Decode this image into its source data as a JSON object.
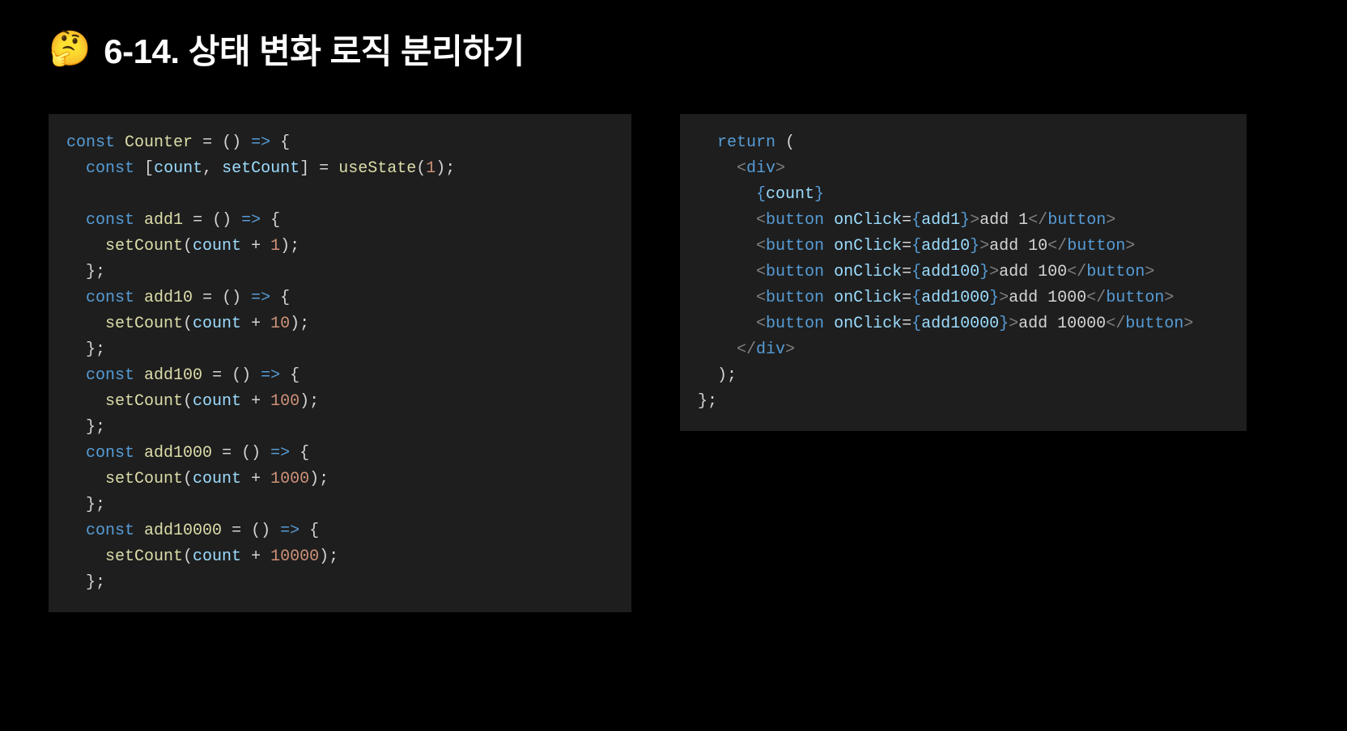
{
  "header": {
    "emoji": "🤔",
    "title": "6-14. 상태 변화 로직 분리하기"
  },
  "code_left": {
    "component_name": "Counter",
    "state_var": "count",
    "state_setter": "setCount",
    "hook": "useState",
    "initial": "1",
    "functions": [
      {
        "name": "add1",
        "value": "1"
      },
      {
        "name": "add10",
        "value": "10"
      },
      {
        "name": "add100",
        "value": "100"
      },
      {
        "name": "add1000",
        "value": "1000"
      },
      {
        "name": "add10000",
        "value": "10000"
      }
    ]
  },
  "code_right": {
    "root_tag": "div",
    "state_ref": "count",
    "buttons": [
      {
        "handler": "add1",
        "label": "add 1"
      },
      {
        "handler": "add10",
        "label": "add 10"
      },
      {
        "handler": "add100",
        "label": "add 100"
      },
      {
        "handler": "add1000",
        "label": "add 1000"
      },
      {
        "handler": "add10000",
        "label": "add 10000"
      }
    ]
  }
}
